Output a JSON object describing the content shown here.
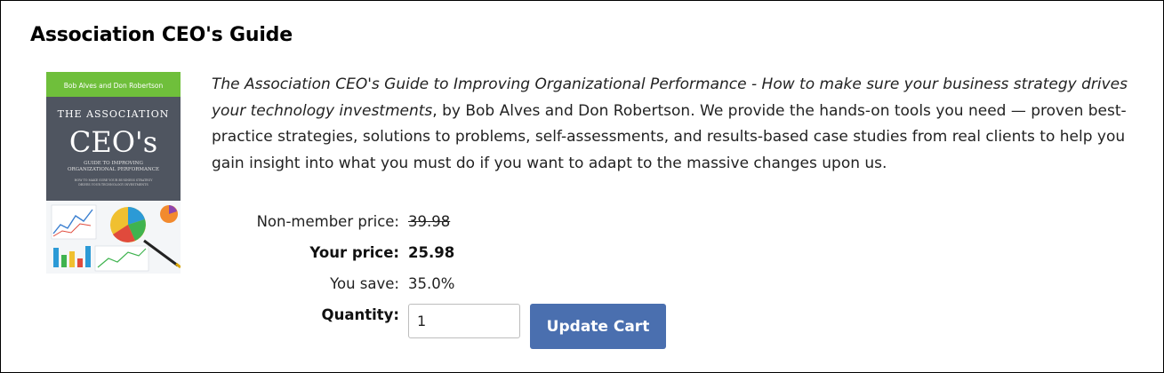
{
  "product": {
    "title": "Association CEO's Guide",
    "cover": {
      "authors_band": "Bob Alves and Don Robertson",
      "line1": "THE ASSOCIATION",
      "line2": "CEO's",
      "line3": "GUIDE TO IMPROVING",
      "line4": "ORGANIZATIONAL PERFORMANCE",
      "line5": "HOW TO MAKE SURE YOUR BUSINESS STRATEGY",
      "line6": "DRIVES YOUR TECHNOLOGY INVESTMENTS",
      "colors": {
        "band": "#6fbf3b",
        "body": "#4f5560"
      }
    },
    "description": {
      "book_title": "The Association CEO's Guide to Improving Organizational Performance - How to make sure your business strategy drives your technology investments",
      "rest": ", by Bob Alves and Don Robertson. We provide the hands-on tools you need — proven best-practice strategies, solutions to problems, self-assessments, and results-based case studies from real clients to help you gain insight into what you must do if you want to adapt to the massive changes upon us."
    }
  },
  "pricing": {
    "nonmember_label": "Non-member price:",
    "nonmember_value": "39.98",
    "your_label": "Your price:",
    "your_value": "25.98",
    "save_label": "You save:",
    "save_value": "35.0%"
  },
  "cart": {
    "quantity_label": "Quantity:",
    "quantity_value": "1",
    "update_label": "Update Cart",
    "accent": "#4a6faf"
  }
}
